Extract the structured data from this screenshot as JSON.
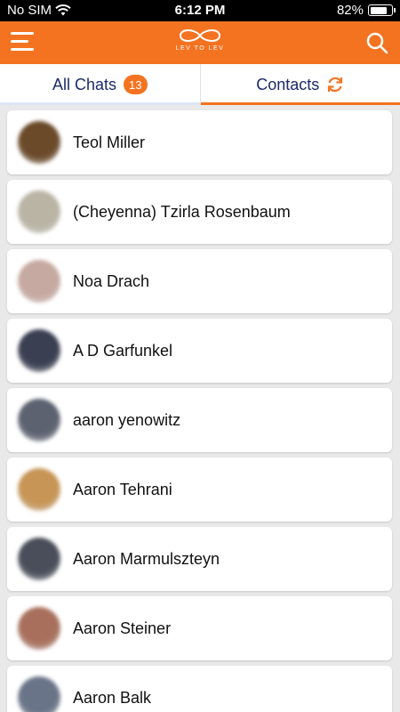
{
  "status_bar": {
    "carrier": "No SIM",
    "time": "6:12 PM",
    "battery": "82%",
    "battery_level": 0.82
  },
  "app_bar": {
    "logo_text": "LEV TO LEV",
    "menu_icon": "hamburger-menu-icon",
    "search_icon": "search-icon"
  },
  "tabs": [
    {
      "label": "All Chats",
      "badge": "13"
    },
    {
      "label": "Contacts",
      "icon": "refresh-icon"
    }
  ],
  "contacts": [
    {
      "name": "Teol Miller",
      "avatar_color": "#6b4a2a"
    },
    {
      "name": "(Cheyenna) Tzirla Rosenbaum",
      "avatar_color": "#b9b4a4"
    },
    {
      "name": "Noa Drach",
      "avatar_color": "#c6a9a0"
    },
    {
      "name": "A D Garfunkel",
      "avatar_color": "#3a3f52"
    },
    {
      "name": "aaron yenowitz",
      "avatar_color": "#5c6270"
    },
    {
      "name": "Aaron Tehrani",
      "avatar_color": "#c79555"
    },
    {
      "name": "Aaron Marmulszteyn",
      "avatar_color": "#4a4e5a"
    },
    {
      "name": "Aaron Steiner",
      "avatar_color": "#a8705c"
    },
    {
      "name": "Aaron Balk",
      "avatar_color": "#6a7488"
    }
  ],
  "colors": {
    "brand_orange": "#f37321",
    "tab_text": "#1b2a6b"
  }
}
